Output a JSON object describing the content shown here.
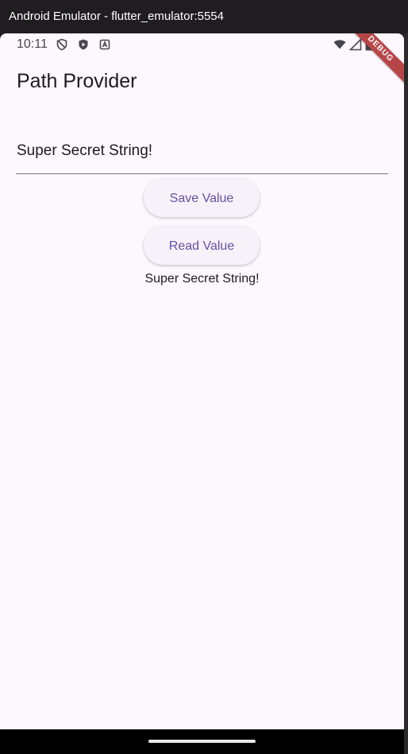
{
  "window": {
    "title": "Android Emulator - flutter_emulator:5554"
  },
  "statusbar": {
    "time": "10:11",
    "icons_left": [
      "shield-outline-icon",
      "play-protect-icon",
      "text-a-icon"
    ],
    "icons_right": [
      "wifi-icon",
      "cellular-signal-icon",
      "battery-icon"
    ]
  },
  "debug_banner": {
    "label": "DEBUG"
  },
  "app": {
    "title": "Path Provider",
    "input": {
      "value": "Super Secret String!"
    },
    "save_button_label": "Save Value",
    "read_button_label": "Read Value",
    "result_text": "Super Secret String!"
  },
  "colors": {
    "screen_background": "#fdf7fe",
    "accent": "#6750a4",
    "button_background": "#f7f1fa",
    "debug_banner": "#b84648",
    "window_chrome": "#201d21"
  }
}
